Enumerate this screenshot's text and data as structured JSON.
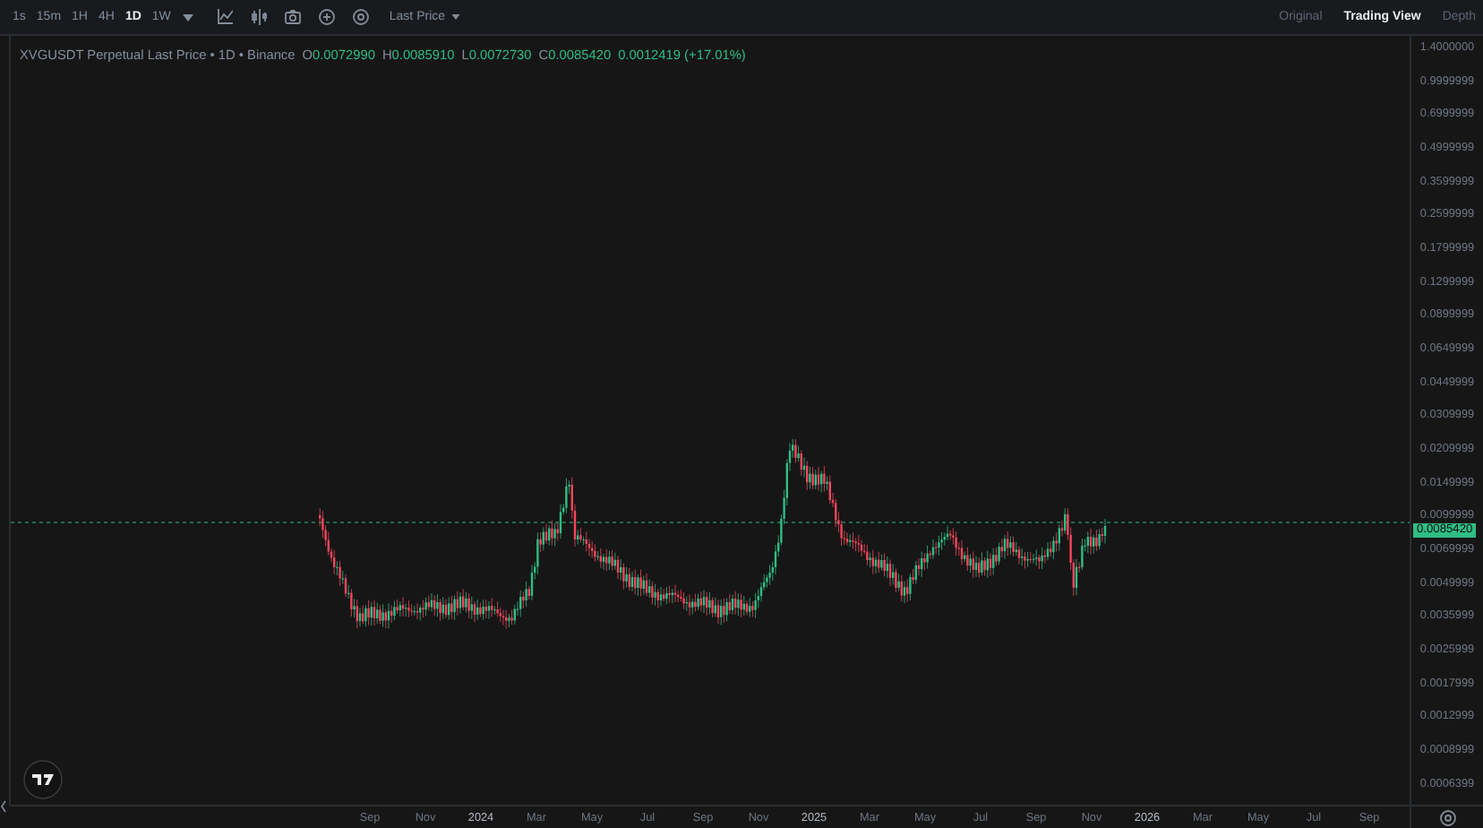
{
  "toolbar": {
    "intervals": [
      {
        "label": "1s",
        "selected": false
      },
      {
        "label": "15m",
        "selected": false
      },
      {
        "label": "1H",
        "selected": false
      },
      {
        "label": "4H",
        "selected": false
      },
      {
        "label": "1D",
        "selected": true
      },
      {
        "label": "1W",
        "selected": false
      }
    ],
    "price_menu": {
      "label": "Last Price"
    },
    "views": [
      {
        "label": "Original",
        "selected": false
      },
      {
        "label": "Trading View",
        "selected": true
      },
      {
        "label": "Depth",
        "selected": false
      }
    ]
  },
  "legend": {
    "title": "XVGUSDT Perpetual Last Price • 1D • Binance",
    "values": [
      {
        "key": "O",
        "value": "0.0072990"
      },
      {
        "key": "H",
        "value": "0.0085910"
      },
      {
        "key": "L",
        "value": "0.0072730"
      },
      {
        "key": "C",
        "value": "0.0085420"
      }
    ],
    "change": "0.0012419 (+17.01%)"
  },
  "price_axis": {
    "labels": [
      "1.4000000",
      "0.9999999",
      "0.6999999",
      "0.4999999",
      "0.3599999",
      "0.2599999",
      "0.1799999",
      "0.1299999",
      "0.0899999",
      "0.0649999",
      "0.0449999",
      "0.0309999",
      "0.0209999",
      "0.0149999",
      "0.0099999",
      "0.0069999",
      "0.0049999",
      "0.0035999",
      "0.0025999",
      "0.0017999",
      "0.0012999",
      "0.0008999",
      "0.0006399"
    ],
    "current": "0.0085420"
  },
  "time_axis": {
    "labels": [
      {
        "text": "Sep",
        "kind": "month"
      },
      {
        "text": "Nov",
        "kind": "month"
      },
      {
        "text": "2024",
        "kind": "year"
      },
      {
        "text": "Mar",
        "kind": "month"
      },
      {
        "text": "May",
        "kind": "month"
      },
      {
        "text": "Jul",
        "kind": "month"
      },
      {
        "text": "Sep",
        "kind": "month"
      },
      {
        "text": "Nov",
        "kind": "month"
      },
      {
        "text": "2025",
        "kind": "year"
      },
      {
        "text": "Mar",
        "kind": "month"
      },
      {
        "text": "May",
        "kind": "month"
      },
      {
        "text": "Jul",
        "kind": "month"
      },
      {
        "text": "Sep",
        "kind": "month"
      },
      {
        "text": "Nov",
        "kind": "month"
      },
      {
        "text": "2026",
        "kind": "year"
      },
      {
        "text": "Mar",
        "kind": "month"
      },
      {
        "text": "May",
        "kind": "month"
      },
      {
        "text": "Jul",
        "kind": "month"
      },
      {
        "text": "Sep",
        "kind": "month"
      }
    ]
  }
}
